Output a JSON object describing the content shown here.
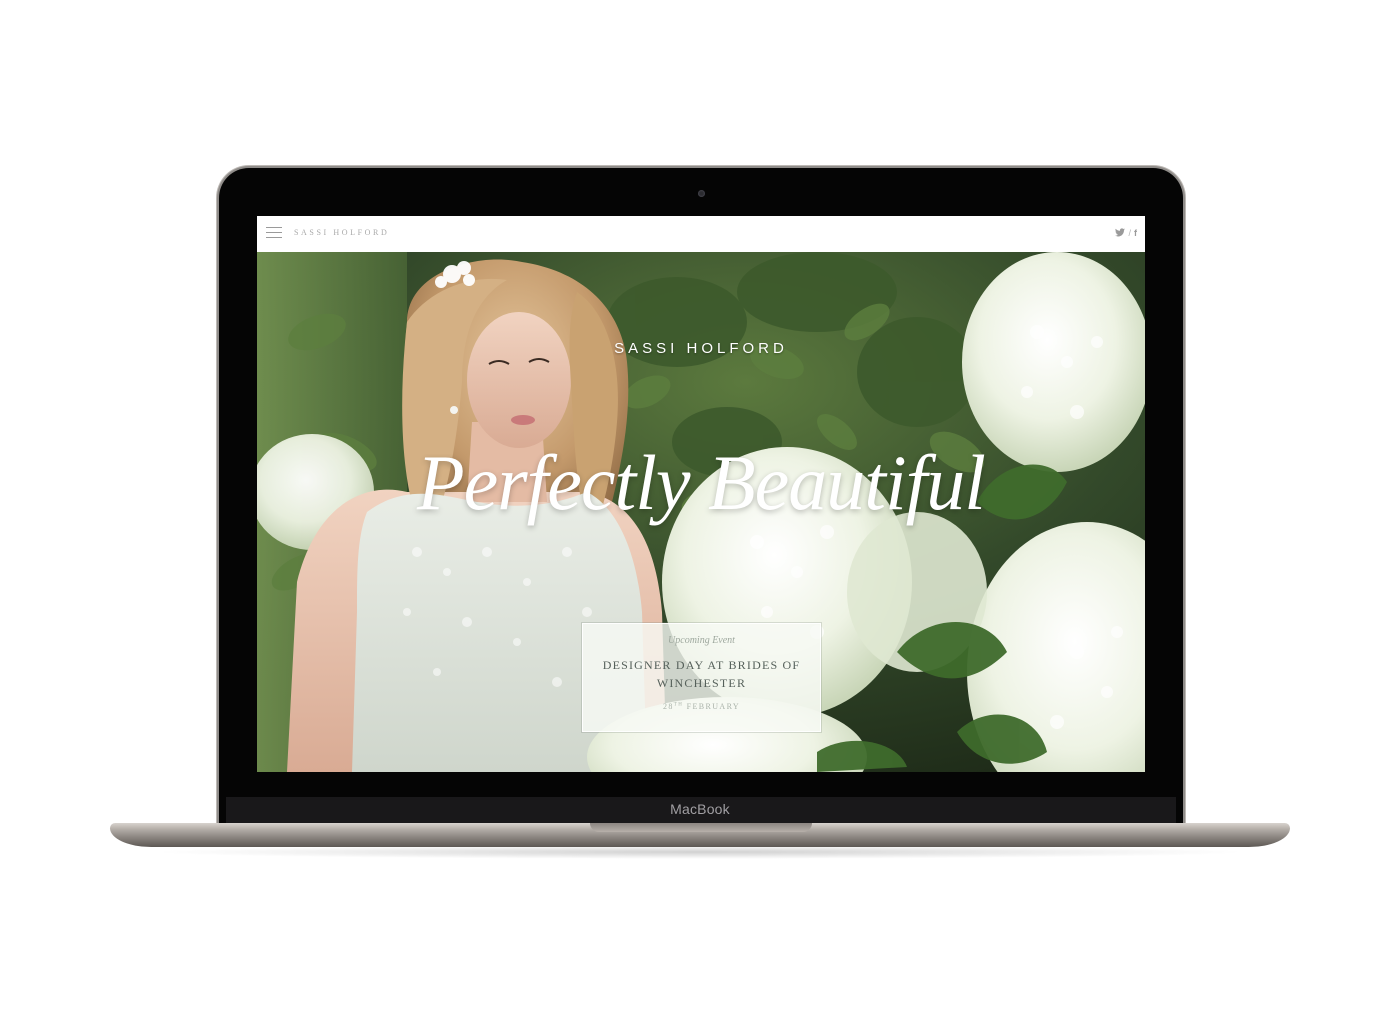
{
  "device": {
    "brand_label": "MacBook"
  },
  "header": {
    "brand": "SASSI HOLFORD",
    "menu_icon": "hamburger-menu-icon",
    "social": {
      "twitter_icon": "twitter-icon",
      "separator": "/",
      "facebook_label": "f"
    }
  },
  "hero": {
    "brand": "SASSI HOLFORD",
    "title": "Perfectly Beautiful",
    "event": {
      "kicker": "Upcoming Event",
      "title": "DESIGNER DAY AT BRIDES OF WINCHESTER",
      "date_day": "28",
      "date_suffix": "TH",
      "date_month": "FEBRUARY"
    }
  },
  "colors": {
    "foliage_dark": "#2f3f25",
    "foliage_mid": "#4e6a36",
    "hydrangea": "#eef3e6",
    "header_bg": "#ffffff",
    "header_text": "#a9a9a9"
  }
}
